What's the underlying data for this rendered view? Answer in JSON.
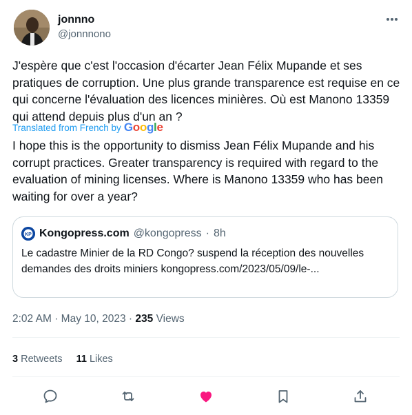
{
  "author": {
    "display_name": "jonnno",
    "handle": "@jonnnono"
  },
  "tweet": {
    "text_original": "J'espère que c'est l'occasion d'écarter Jean Félix Mupande et ses pratiques de corruption. Une plus grande transparence est requise en ce qui concerne l'évaluation des licences minières. Où est Manono 13359 qui attend depuis plus d'un an ?",
    "translated_label": "Translated from French by",
    "translator": "Google",
    "text_translated": "I hope this is the opportunity to dismiss Jean Félix Mupande and his corrupt practices. Greater transparency is required with regard to the evaluation of mining licenses. Where is Manono 13359 who has been waiting for over a year?"
  },
  "quote": {
    "name": "Kongopress.com",
    "handle": "@kongopress",
    "separator": "·",
    "age": "8h",
    "text": "Le cadastre Minier de la RD Congo? suspend la réception des nouvelles demandes des droits miniers kongopress.com/2023/05/09/le-..."
  },
  "meta": {
    "time": "2:02 AM",
    "dot1": "·",
    "date": "May 10, 2023",
    "dot2": "·",
    "views_count": "235",
    "views_label": "Views"
  },
  "stats": {
    "retweets_count": "3",
    "retweets_label": "Retweets",
    "likes_count": "11",
    "likes_label": "Likes"
  },
  "icons": {
    "more": "more-icon",
    "reply": "reply-icon",
    "retweet": "retweet-icon",
    "like": "heart-icon",
    "bookmark": "bookmark-icon",
    "share": "share-icon"
  },
  "colors": {
    "link": "#1d9bf0",
    "like": "#f91880",
    "muted": "#536471"
  }
}
